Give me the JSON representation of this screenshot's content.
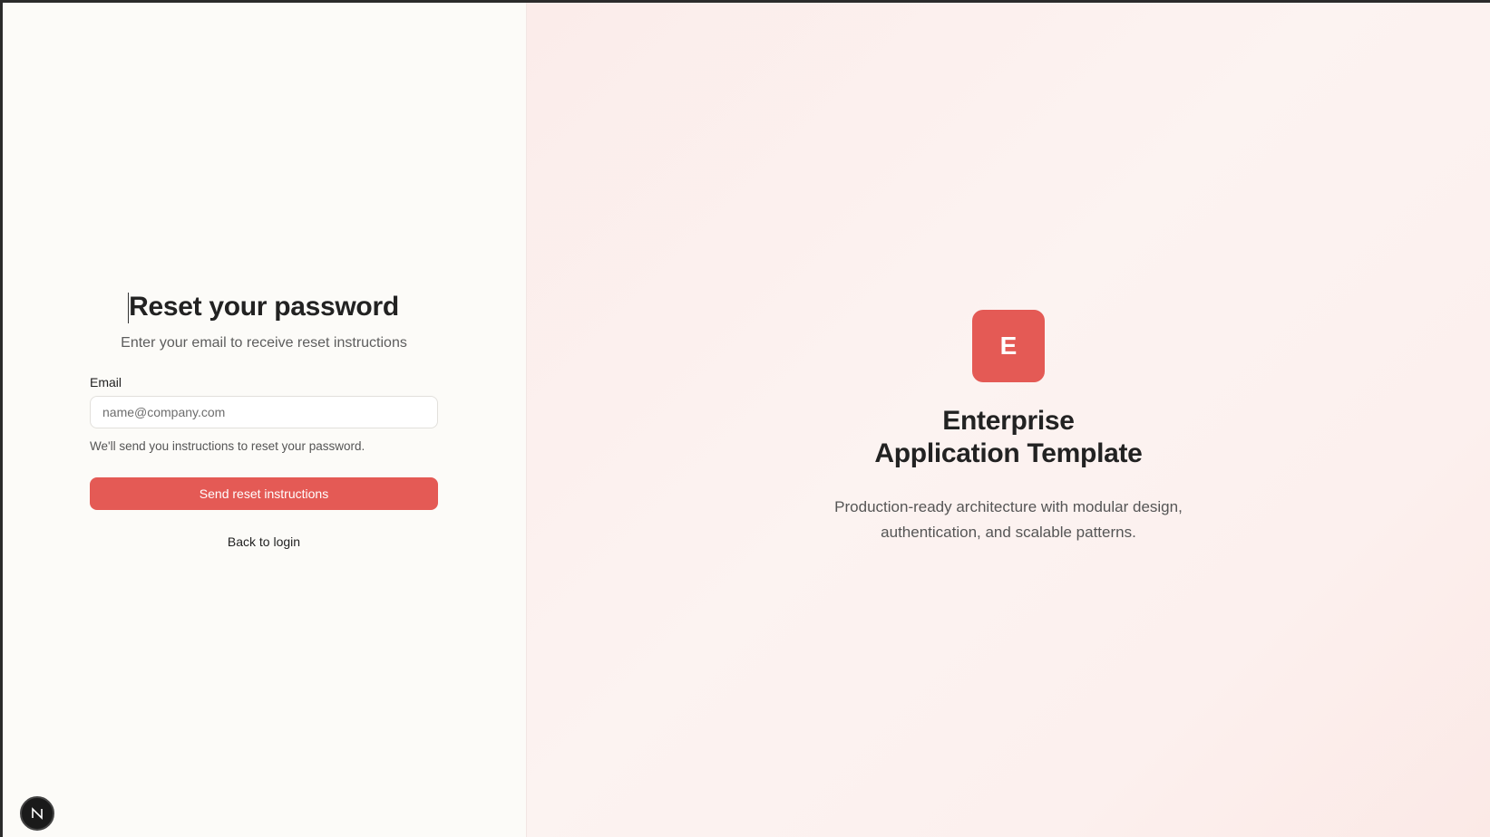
{
  "form": {
    "title": "Reset your password",
    "subtitle": "Enter your email to receive reset instructions",
    "email_label": "Email",
    "email_placeholder": "name@company.com",
    "email_value": "",
    "hint": "We'll send you instructions to reset your password.",
    "submit_label": "Send reset instructions",
    "back_link": "Back to login"
  },
  "brand": {
    "logo_letter": "E",
    "title_line1": "Enterprise",
    "title_line2": "Application Template",
    "description": "Production-ready architecture with modular design, authentication, and scalable patterns."
  },
  "dev_badge": {
    "icon": "nextjs-logo-icon"
  },
  "colors": {
    "accent": "#e45a55",
    "left_bg": "#fcfbf8",
    "right_bg": "#fcf0ee"
  }
}
